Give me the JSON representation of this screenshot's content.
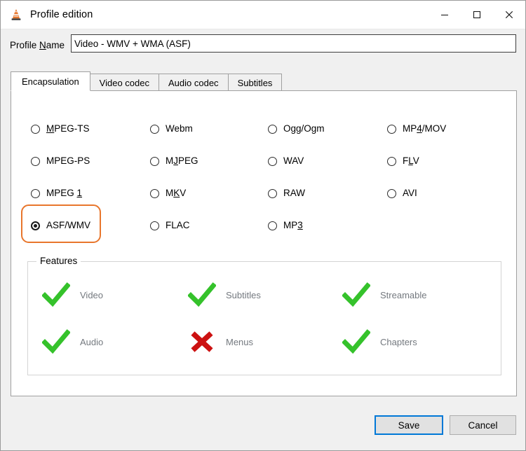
{
  "window": {
    "title": "Profile edition",
    "icon": "vlc-cone-icon",
    "controls": {
      "minimize": "minimize-icon",
      "maximize": "maximize-icon",
      "close": "close-icon"
    }
  },
  "profile": {
    "label_prefix": "Profile ",
    "label_accel": "N",
    "label_suffix": "ame",
    "value": "Video - WMV + WMA (ASF)",
    "placeholder": ""
  },
  "tabs": [
    {
      "label": "Encapsulation",
      "active": true
    },
    {
      "label": "Video codec",
      "active": false
    },
    {
      "label": "Audio codec",
      "active": false
    },
    {
      "label": "Subtitles",
      "active": false
    }
  ],
  "encapsulation": {
    "selected": "ASF/WMV",
    "options": [
      {
        "label": "MPEG-TS",
        "accel": "M",
        "accel_index": 0,
        "checked": false,
        "col": 0,
        "row": 0
      },
      {
        "label": "MPEG-PS",
        "accel": "",
        "accel_index": -1,
        "checked": false,
        "col": 0,
        "row": 1
      },
      {
        "label": "MPEG 1",
        "accel": "1",
        "accel_index": 5,
        "checked": false,
        "col": 0,
        "row": 2
      },
      {
        "label": "ASF/WMV",
        "accel": "",
        "accel_index": -1,
        "checked": true,
        "col": 0,
        "row": 3
      },
      {
        "label": "Webm",
        "accel": "",
        "accel_index": -1,
        "checked": false,
        "col": 1,
        "row": 0
      },
      {
        "label": "MJPEG",
        "accel": "J",
        "accel_index": 1,
        "checked": false,
        "col": 1,
        "row": 1
      },
      {
        "label": "MKV",
        "accel": "K",
        "accel_index": 1,
        "checked": false,
        "col": 1,
        "row": 2
      },
      {
        "label": "FLAC",
        "accel": "",
        "accel_index": -1,
        "checked": false,
        "col": 1,
        "row": 3
      },
      {
        "label": "Ogg/Ogm",
        "accel": "gg",
        "accel_index": 1,
        "checked": false,
        "col": 2,
        "row": 0
      },
      {
        "label": "WAV",
        "accel": "",
        "accel_index": -1,
        "checked": false,
        "col": 2,
        "row": 1
      },
      {
        "label": "RAW",
        "accel": "",
        "accel_index": -1,
        "checked": false,
        "col": 2,
        "row": 2
      },
      {
        "label": "MP3",
        "accel": "3",
        "accel_index": 2,
        "checked": false,
        "col": 2,
        "row": 3
      },
      {
        "label": "MP4/MOV",
        "accel": "4",
        "accel_index": 2,
        "checked": false,
        "col": 3,
        "row": 0
      },
      {
        "label": "FLV",
        "accel": "L",
        "accel_index": 1,
        "checked": false,
        "col": 3,
        "row": 1
      },
      {
        "label": "AVI",
        "accel": "",
        "accel_index": -1,
        "checked": false,
        "col": 3,
        "row": 2
      }
    ]
  },
  "features": {
    "legend": "Features",
    "items": [
      {
        "label": "Video",
        "state": "yes",
        "col": 0,
        "row": 0
      },
      {
        "label": "Audio",
        "state": "yes",
        "col": 0,
        "row": 1
      },
      {
        "label": "Subtitles",
        "state": "yes",
        "col": 1,
        "row": 0
      },
      {
        "label": "Menus",
        "state": "no",
        "col": 1,
        "row": 1
      },
      {
        "label": "Streamable",
        "state": "yes",
        "col": 2,
        "row": 0
      },
      {
        "label": "Chapters",
        "state": "yes",
        "col": 2,
        "row": 1
      }
    ]
  },
  "buttons": {
    "save": "Save",
    "cancel": "Cancel"
  },
  "colors": {
    "accent_selection": "#e8762c",
    "check_green": "#35c22b",
    "cross_red": "#cc1111",
    "focus_blue": "#0078d7",
    "dialog_bg": "#f0f0f0",
    "panel_bg": "#ffffff"
  }
}
